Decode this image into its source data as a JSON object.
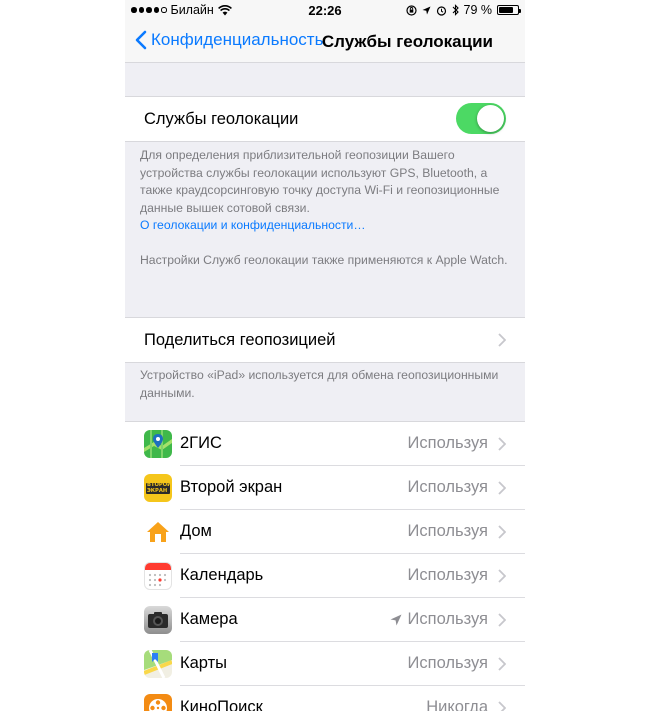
{
  "status_bar": {
    "carrier": "Билайн",
    "time": "22:26",
    "battery_percent": "79 %",
    "battery_level": 0.79
  },
  "nav": {
    "back_label": "Конфиденциальность",
    "title": "Службы геолокации"
  },
  "location_services": {
    "label": "Службы геолокации",
    "enabled": true,
    "footer_text": "Для определения приблизительной геопозиции Вашего устройства службы геолокации используют GPS, Bluetooth, а также краудсорсинговую точку доступа Wi-Fi и геопозиционные данные вышек сотовой связи.",
    "footer_link": "О геолокации и конфиденциальности…",
    "footer_watch": "Настройки Служб геолокации также применяются к Apple Watch."
  },
  "share_location": {
    "label": "Поделиться геопозицией",
    "footer_text": "Устройство «iPad» используется для обмена геопозиционными данными."
  },
  "apps": [
    {
      "name": "2ГИС",
      "value": "Используя",
      "icon": "2gis-icon",
      "arrow": false
    },
    {
      "name": "Второй экран",
      "value": "Используя",
      "icon": "second-screen-icon",
      "icon_text": "ВТОРОЙ ЭКРАН",
      "arrow": false
    },
    {
      "name": "Дом",
      "value": "Используя",
      "icon": "home-icon",
      "arrow": false
    },
    {
      "name": "Календарь",
      "value": "Используя",
      "icon": "calendar-icon",
      "arrow": false
    },
    {
      "name": "Камера",
      "value": "Используя",
      "icon": "camera-icon",
      "arrow": true
    },
    {
      "name": "Карты",
      "value": "Используя",
      "icon": "maps-icon",
      "arrow": false
    },
    {
      "name": "КиноПоиск",
      "value": "Никогда",
      "icon": "kinopoisk-icon",
      "arrow": false
    }
  ],
  "colors": {
    "accent": "#0a7aff",
    "toggle_on": "#4cd964",
    "background": "#efeff4"
  }
}
